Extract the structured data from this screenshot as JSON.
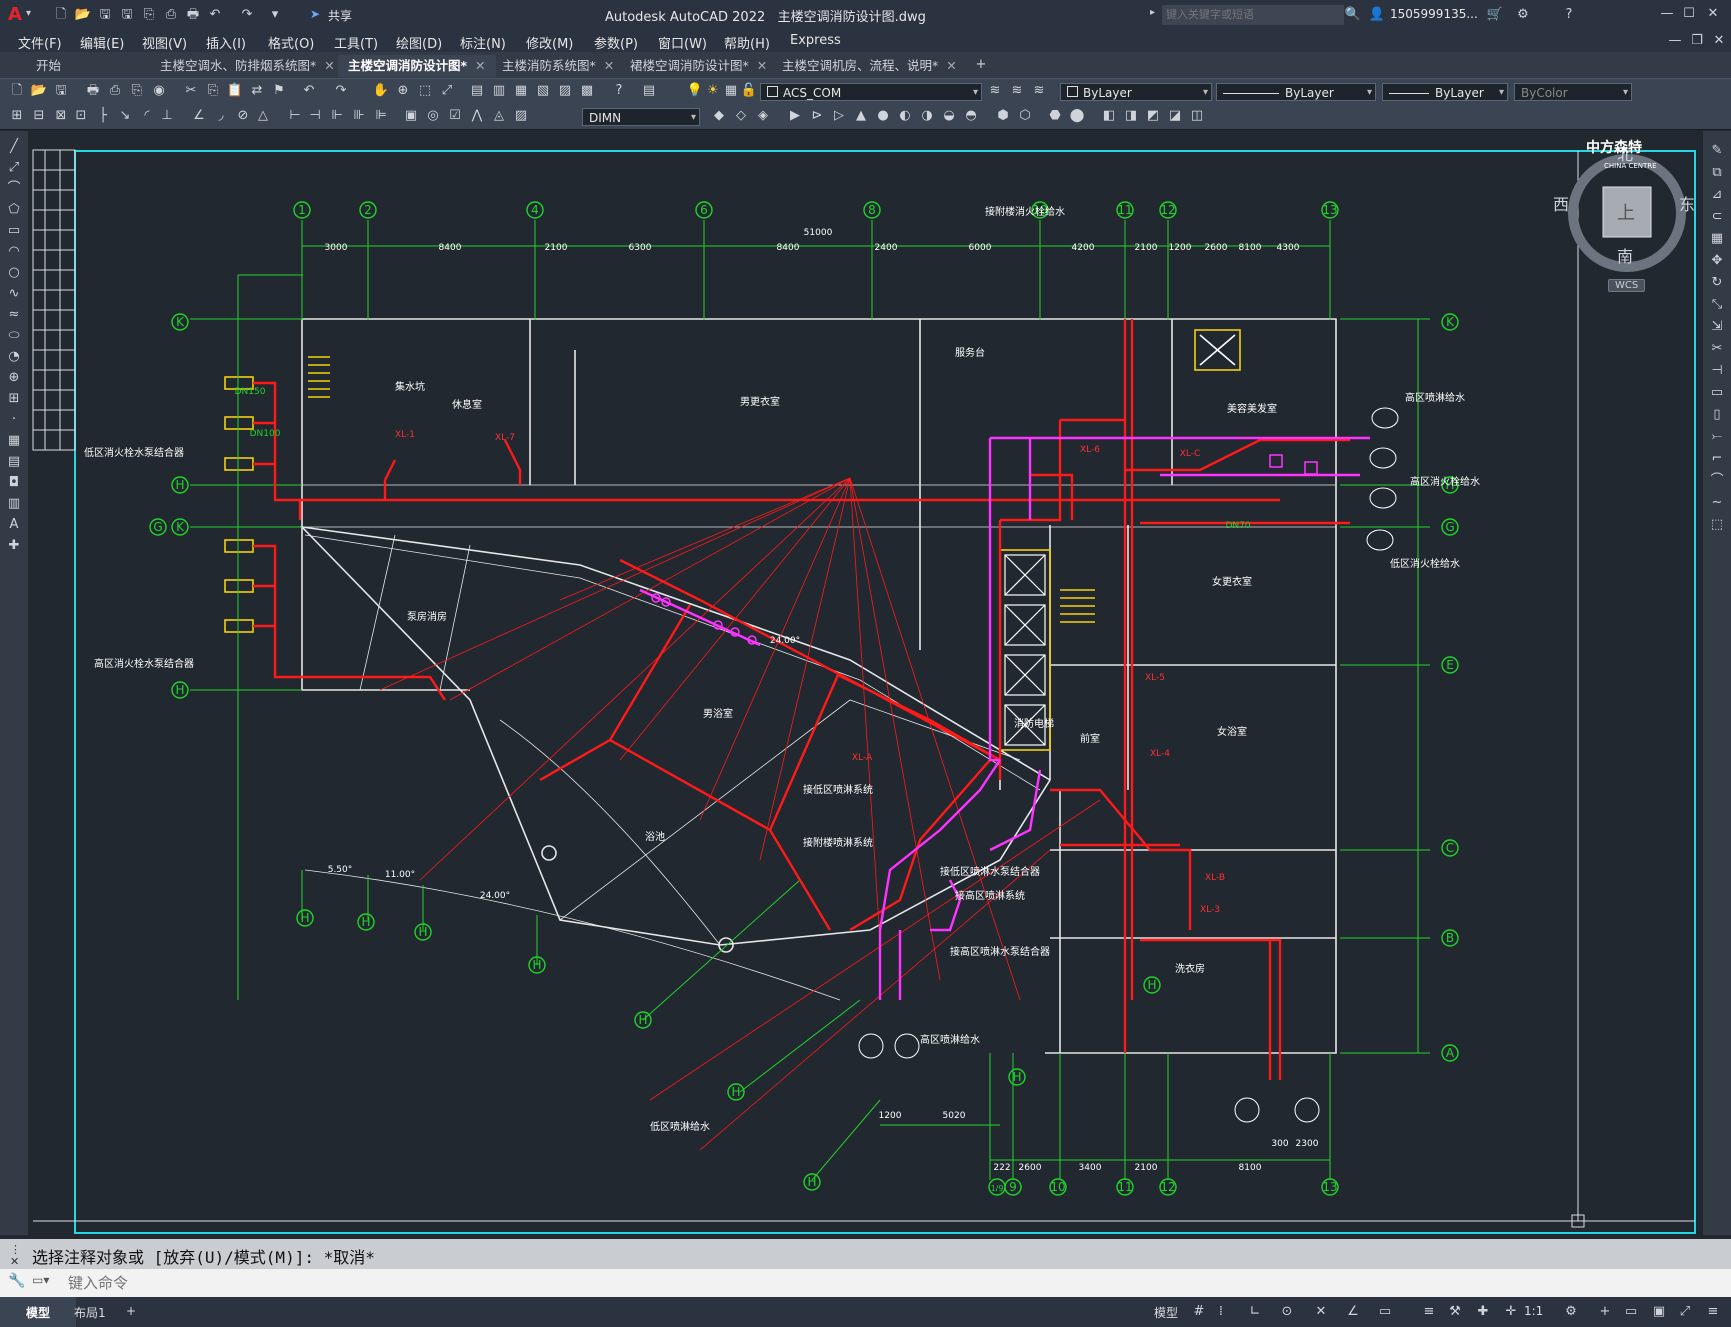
{
  "app": {
    "title": "Autodesk AutoCAD 2022",
    "filename": "主楼空调消防设计图.dwg",
    "share_label": "共享",
    "search_placeholder": "键入关键字或短语",
    "user": "1505999135...",
    "logo_letter": "A"
  },
  "menu": [
    "文件(F)",
    "编辑(E)",
    "视图(V)",
    "插入(I)",
    "格式(O)",
    "工具(T)",
    "绘图(D)",
    "标注(N)",
    "修改(M)",
    "参数(P)",
    "窗口(W)",
    "帮助(H)",
    "Express"
  ],
  "tabs": [
    {
      "label": "开始",
      "active": false
    },
    {
      "label": "主楼空调水、防排烟系统图*",
      "active": false
    },
    {
      "label": "主楼空调消防设计图*",
      "active": true
    },
    {
      "label": "主楼消防系统图*",
      "active": false
    },
    {
      "label": "裙楼空调消防设计图*",
      "active": false
    },
    {
      "label": "主楼空调机房、流程、说明*",
      "active": false
    }
  ],
  "toolbar": {
    "layer": "ACS_COM",
    "color": "ByLayer",
    "linetype": "ByLayer",
    "lineweight": "ByLayer",
    "plotstyle": "ByColor",
    "dimstyle": "DIMN"
  },
  "viewcube": {
    "north": "北",
    "south": "南",
    "east": "东",
    "west": "西",
    "face": "上",
    "wcs": "WCS"
  },
  "watermark": {
    "title": "中方森特",
    "subtitle": "CHINA CENTRE"
  },
  "drawing": {
    "grid_top": [
      "1",
      "2",
      "4",
      "6",
      "8",
      "10",
      "11",
      "12",
      "13"
    ],
    "grid_right": [
      "K",
      "H",
      "G",
      "E",
      "C",
      "B",
      "A"
    ],
    "grid_bottom": [
      "1/9",
      "9",
      "10",
      "11",
      "12",
      "13"
    ],
    "dims_top": [
      "3000",
      "8400",
      "2100",
      "6300",
      "8400",
      "2400",
      "6000",
      "4200",
      "2100",
      "1200",
      "2600",
      "8100",
      "4300"
    ],
    "overall_dim": "51000",
    "rooms": [
      "休息室",
      "男更衣室",
      "服务台",
      "美容美发室",
      "女更衣室",
      "女浴室",
      "泵房消房",
      "男浴室",
      "浴池",
      "洗衣房",
      "前室",
      "消防电梯",
      "集水坑"
    ],
    "labels": [
      "低区消火栓水泵结合器",
      "高区消火栓水泵结合器",
      "接附楼消火栓给水",
      "高区喷淋给水",
      "高区消火栓给水",
      "低区消火栓给水",
      "接低区喷淋系统",
      "接附楼喷淋系统",
      "接低区喷淋水泵结合器",
      "接高区喷淋系统",
      "接高区喷淋水泵结合器",
      "低区喷淋给水",
      "高区喷淋给水"
    ],
    "pipe_tags": [
      "DN150",
      "DN100",
      "DN70",
      "XL-1",
      "XL-7",
      "XL-6",
      "XL-C",
      "XL-5",
      "XL-4",
      "XL-B",
      "XL-3",
      "XL-A"
    ],
    "dim_bottom": [
      "222",
      "2600",
      "3400",
      "2100",
      "8100",
      "1200",
      "5020",
      "300",
      "2300"
    ],
    "angles": [
      "5.50°",
      "11.00°",
      "24.00°"
    ]
  },
  "command": {
    "history": "选择注释对象或 [放弃(U)/模式(M)]: *取消*",
    "placeholder": "键入命令"
  },
  "status": {
    "model_tab": "模型",
    "layout_tab": "布局1",
    "model_space": "模型",
    "scale": "1:1"
  }
}
